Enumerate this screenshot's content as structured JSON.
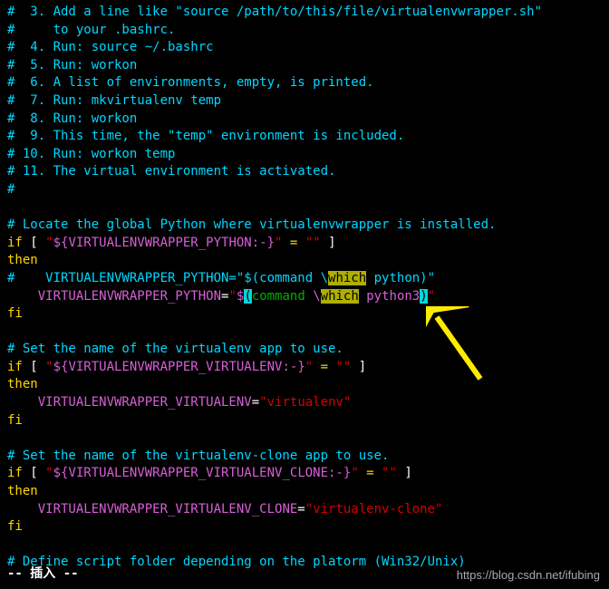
{
  "lines": [
    {
      "segments": [
        {
          "cls": "cyan",
          "text": "#  3. Add a line like \"source /path/to/this/file/virtualenvwrapper.sh\""
        }
      ]
    },
    {
      "segments": [
        {
          "cls": "cyan",
          "text": "#     to your .bashrc."
        }
      ]
    },
    {
      "segments": [
        {
          "cls": "cyan",
          "text": "#  4. Run: source ~/.bashrc"
        }
      ]
    },
    {
      "segments": [
        {
          "cls": "cyan",
          "text": "#  5. Run: workon"
        }
      ]
    },
    {
      "segments": [
        {
          "cls": "cyan",
          "text": "#  6. A list of environments, empty, is printed."
        }
      ]
    },
    {
      "segments": [
        {
          "cls": "cyan",
          "text": "#  7. Run: mkvirtualenv temp"
        }
      ]
    },
    {
      "segments": [
        {
          "cls": "cyan",
          "text": "#  8. Run: workon"
        }
      ]
    },
    {
      "segments": [
        {
          "cls": "cyan",
          "text": "#  9. This time, the \"temp\" environment is included."
        }
      ]
    },
    {
      "segments": [
        {
          "cls": "cyan",
          "text": "# 10. Run: workon temp"
        }
      ]
    },
    {
      "segments": [
        {
          "cls": "cyan",
          "text": "# 11. The virtual environment is activated."
        }
      ]
    },
    {
      "segments": [
        {
          "cls": "cyan",
          "text": "#"
        }
      ]
    },
    {
      "segments": [
        {
          "cls": "white",
          "text": " "
        }
      ]
    },
    {
      "segments": [
        {
          "cls": "cyan",
          "text": "# Locate the global Python where virtualenvwrapper is installed."
        }
      ]
    },
    {
      "segments": [
        {
          "cls": "yellow",
          "text": "if"
        },
        {
          "cls": "white",
          "text": " [ "
        },
        {
          "cls": "red",
          "text": "\""
        },
        {
          "cls": "magenta",
          "text": "${VIRTUALENVWRAPPER_PYTHON:-}"
        },
        {
          "cls": "red",
          "text": "\""
        },
        {
          "cls": "white",
          "text": " "
        },
        {
          "cls": "yellow",
          "text": "="
        },
        {
          "cls": "white",
          "text": " "
        },
        {
          "cls": "red",
          "text": "\"\""
        },
        {
          "cls": "white",
          "text": " ]"
        }
      ]
    },
    {
      "segments": [
        {
          "cls": "yellow",
          "text": "then"
        }
      ]
    },
    {
      "segments": [
        {
          "cls": "cyan",
          "text": "#    VIRTUALENVWRAPPER_PYTHON=\"$(command \\"
        },
        {
          "cls": "hl-which",
          "text": "which"
        },
        {
          "cls": "cyan",
          "text": " python)\""
        }
      ]
    },
    {
      "segments": [
        {
          "cls": "white",
          "text": "    "
        },
        {
          "cls": "magenta",
          "text": "VIRTUALENVWRAPPER_PYTHON"
        },
        {
          "cls": "white",
          "text": "="
        },
        {
          "cls": "red",
          "text": "\""
        },
        {
          "cls": "magenta",
          "text": "$"
        },
        {
          "cls": "hl-paren",
          "text": "("
        },
        {
          "cls": "green",
          "text": "command "
        },
        {
          "cls": "magenta",
          "text": "\\"
        },
        {
          "cls": "hl-which",
          "text": "which"
        },
        {
          "cls": "green",
          "text": " "
        },
        {
          "cls": "magenta",
          "text": "python3"
        },
        {
          "cls": "hl-paren",
          "text": ")"
        },
        {
          "cls": "red",
          "text": "\""
        }
      ]
    },
    {
      "segments": [
        {
          "cls": "yellow",
          "text": "fi"
        }
      ]
    },
    {
      "segments": [
        {
          "cls": "white",
          "text": " "
        }
      ]
    },
    {
      "segments": [
        {
          "cls": "cyan",
          "text": "# Set the name of the virtualenv app to use."
        }
      ]
    },
    {
      "segments": [
        {
          "cls": "yellow",
          "text": "if"
        },
        {
          "cls": "white",
          "text": " [ "
        },
        {
          "cls": "red",
          "text": "\""
        },
        {
          "cls": "magenta",
          "text": "${VIRTUALENVWRAPPER_VIRTUALENV:-}"
        },
        {
          "cls": "red",
          "text": "\""
        },
        {
          "cls": "white",
          "text": " "
        },
        {
          "cls": "yellow",
          "text": "="
        },
        {
          "cls": "white",
          "text": " "
        },
        {
          "cls": "red",
          "text": "\"\""
        },
        {
          "cls": "white",
          "text": " ]"
        }
      ]
    },
    {
      "segments": [
        {
          "cls": "yellow",
          "text": "then"
        }
      ]
    },
    {
      "segments": [
        {
          "cls": "white",
          "text": "    "
        },
        {
          "cls": "magenta",
          "text": "VIRTUALENVWRAPPER_VIRTUALENV"
        },
        {
          "cls": "white",
          "text": "="
        },
        {
          "cls": "red",
          "text": "\"virtualenv\""
        }
      ]
    },
    {
      "segments": [
        {
          "cls": "yellow",
          "text": "fi"
        }
      ]
    },
    {
      "segments": [
        {
          "cls": "white",
          "text": " "
        }
      ]
    },
    {
      "segments": [
        {
          "cls": "cyan",
          "text": "# Set the name of the virtualenv-clone app to use."
        }
      ]
    },
    {
      "segments": [
        {
          "cls": "yellow",
          "text": "if"
        },
        {
          "cls": "white",
          "text": " [ "
        },
        {
          "cls": "red",
          "text": "\""
        },
        {
          "cls": "magenta",
          "text": "${VIRTUALENVWRAPPER_VIRTUALENV_CLONE:-}"
        },
        {
          "cls": "red",
          "text": "\""
        },
        {
          "cls": "white",
          "text": " "
        },
        {
          "cls": "yellow",
          "text": "="
        },
        {
          "cls": "white",
          "text": " "
        },
        {
          "cls": "red",
          "text": "\"\""
        },
        {
          "cls": "white",
          "text": " ]"
        }
      ]
    },
    {
      "segments": [
        {
          "cls": "yellow",
          "text": "then"
        }
      ]
    },
    {
      "segments": [
        {
          "cls": "white",
          "text": "    "
        },
        {
          "cls": "magenta",
          "text": "VIRTUALENVWRAPPER_VIRTUALENV_CLONE"
        },
        {
          "cls": "white",
          "text": "="
        },
        {
          "cls": "red",
          "text": "\"virtualenv-clone\""
        }
      ]
    },
    {
      "segments": [
        {
          "cls": "yellow",
          "text": "fi"
        }
      ]
    },
    {
      "segments": [
        {
          "cls": "white",
          "text": " "
        }
      ]
    },
    {
      "segments": [
        {
          "cls": "cyan",
          "text": "# Define script folder depending on the platorm (Win32/Unix)"
        }
      ]
    }
  ],
  "status_mode": "-- 插入 --",
  "watermark": "https://blog.csdn.net/ifubing"
}
